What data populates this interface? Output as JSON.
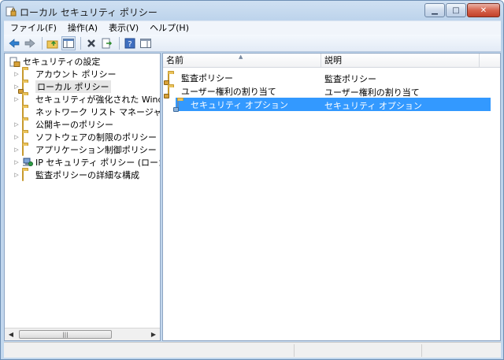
{
  "window": {
    "title": "ローカル セキュリティ ポリシー"
  },
  "menu": [
    "ファイル(F)",
    "操作(A)",
    "表示(V)",
    "ヘルプ(H)"
  ],
  "tree": {
    "root": "セキュリティの設定",
    "items": [
      {
        "label": "アカウント ポリシー",
        "icon": "folder-icon",
        "expander": true
      },
      {
        "label": "ローカル ポリシー",
        "icon": "folder-lock-icon",
        "expander": true,
        "selected": true
      },
      {
        "label": "セキュリティが強化された Windows",
        "icon": "folder-icon",
        "expander": true
      },
      {
        "label": "ネットワーク リスト マネージャー ポ",
        "icon": "folder-icon",
        "expander": false
      },
      {
        "label": "公開キーのポリシー",
        "icon": "folder-icon",
        "expander": true
      },
      {
        "label": "ソフトウェアの制限のポリシー",
        "icon": "folder-icon",
        "expander": true
      },
      {
        "label": "アプリケーション制御ポリシー",
        "icon": "folder-icon",
        "expander": true
      },
      {
        "label": "IP セキュリティ ポリシー (ローカル",
        "icon": "ipsec-icon",
        "expander": true
      },
      {
        "label": "監査ポリシーの詳細な構成",
        "icon": "folder-icon",
        "expander": true
      }
    ]
  },
  "list": {
    "columns": [
      "名前",
      "説明"
    ],
    "rows": [
      {
        "name": "監査ポリシー",
        "desc": "監査ポリシー",
        "icon": "folder-lock-icon"
      },
      {
        "name": "ユーザー権利の割り当て",
        "desc": "ユーザー権利の割り当て",
        "icon": "folder-lock-icon"
      },
      {
        "name": "セキュリティ オプション",
        "desc": "セキュリティ オプション",
        "icon": "folder-lock-icon",
        "selected": true
      }
    ]
  },
  "colors": {
    "selection": "#3399ff",
    "titlebar": "#c3d8ee"
  }
}
